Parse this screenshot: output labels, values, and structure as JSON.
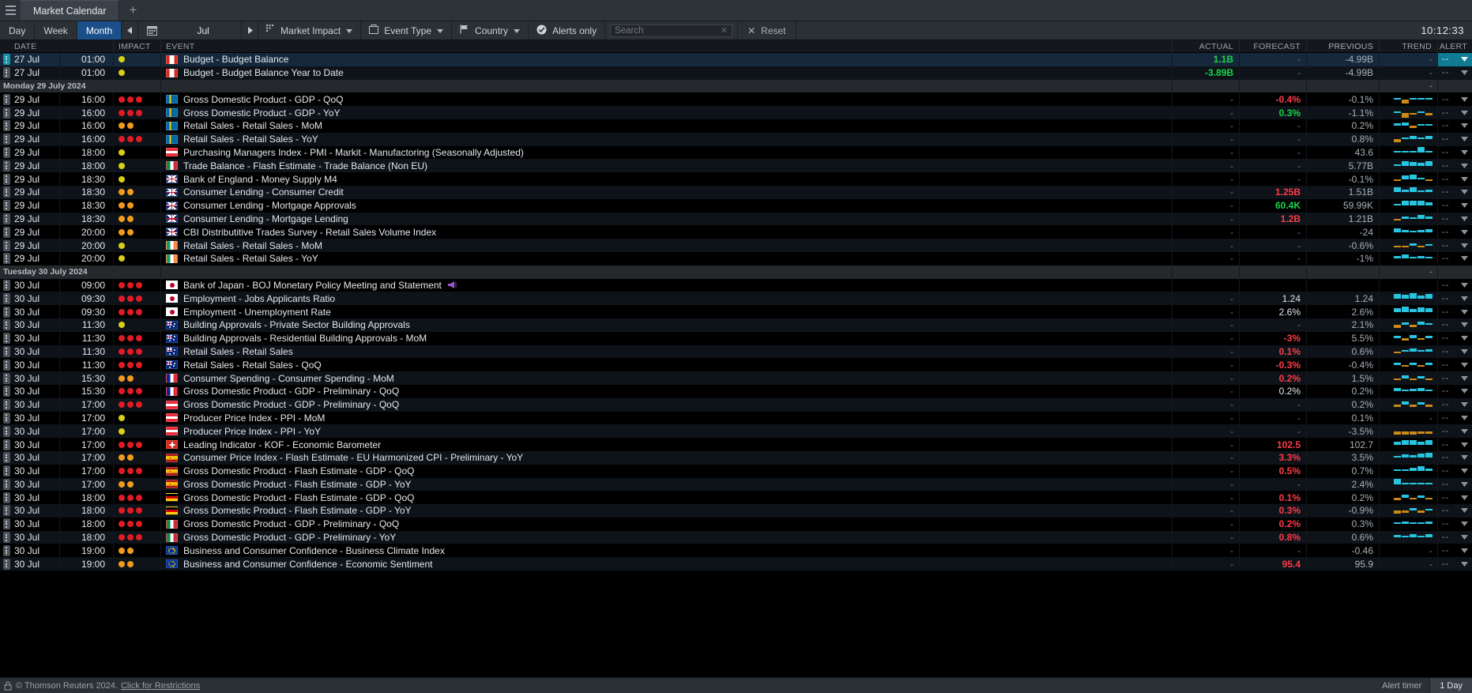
{
  "window": {
    "tab_title": "Market Calendar",
    "add_tab": "+"
  },
  "toolbar": {
    "views": [
      "Day",
      "Week",
      "Month"
    ],
    "selected_view": "Month",
    "prev_arrow": "◀",
    "next_arrow": "▶",
    "month_label": "Jul",
    "filters": [
      {
        "label": "Market Impact",
        "icon": "dots-grid-icon"
      },
      {
        "label": "Event Type",
        "icon": "calendar-box-icon"
      },
      {
        "label": "Country",
        "icon": "flag-icon"
      }
    ],
    "alerts_only": "Alerts only",
    "search_placeholder": "Search",
    "reset_label": "Reset",
    "clock": "10:12:33"
  },
  "columns": [
    "DATE",
    "IMPACT",
    "EVENT",
    "ACTUAL",
    "FORECAST",
    "PREVIOUS",
    "TREND",
    "ALERT"
  ],
  "colors": {
    "positive": "#19d44a",
    "negative": "#ff3b4a",
    "selection": "#16293c",
    "alert_active": "#0f7c93",
    "impact_high": "#e01b24",
    "impact_med": "#f29a1d",
    "impact_low": "#d9cf17",
    "spark_up": "#29c5e0",
    "spark_down": "#c98a18"
  },
  "rows": [
    {
      "kind": "event",
      "selected": true,
      "handle": "active",
      "date": "27 Jul",
      "time": "01:00",
      "impact": [
        "y"
      ],
      "flag": "ca",
      "event": "Budget - Budget Balance",
      "actual": "1.1B",
      "actual_tone": "pos",
      "forecast": "-",
      "forecast_tone": "dash",
      "previous": "-4.99B",
      "trend": [],
      "trend_dash": true,
      "alert": "--"
    },
    {
      "kind": "event",
      "handle": "idle",
      "date": "27 Jul",
      "time": "01:00",
      "impact": [
        "y"
      ],
      "flag": "ca",
      "event": "Budget - Budget Balance Year to Date",
      "actual": "-3.89B",
      "actual_tone": "pos",
      "forecast": "-",
      "forecast_tone": "dash",
      "previous": "-4.99B",
      "trend": [],
      "trend_dash": true,
      "alert": "--"
    },
    {
      "kind": "day",
      "label": "Monday 29 July 2024"
    },
    {
      "kind": "event",
      "handle": "idle",
      "date": "29 Jul",
      "time": "16:00",
      "impact": [
        "r",
        "r",
        "r"
      ],
      "flag": "se",
      "event": "Gross Domestic Product - GDP - QoQ",
      "actual": "-",
      "actual_tone": "dash",
      "forecast": "-0.4%",
      "forecast_tone": "neg",
      "previous": "-0.1%",
      "trend": [
        8,
        -38,
        6,
        4,
        3
      ],
      "alert": "--"
    },
    {
      "kind": "event",
      "handle": "idle",
      "date": "29 Jul",
      "time": "16:00",
      "impact": [
        "r",
        "r",
        "r"
      ],
      "flag": "se",
      "event": "Gross Domestic Product - GDP - YoY",
      "actual": "-",
      "actual_tone": "dash",
      "forecast": "0.3%",
      "forecast_tone": "pos",
      "previous": "-1.1%",
      "trend": [
        6,
        -42,
        -18,
        4,
        -22
      ],
      "alert": "--"
    },
    {
      "kind": "event",
      "handle": "idle",
      "date": "29 Jul",
      "time": "16:00",
      "impact": [
        "o",
        "o"
      ],
      "flag": "se",
      "event": "Retail Sales - Retail Sales - MoM",
      "actual": "-",
      "actual_tone": "dash",
      "forecast": "-",
      "forecast_tone": "dash",
      "previous": "0.2%",
      "trend": [
        22,
        30,
        -20,
        14,
        12
      ],
      "alert": "--"
    },
    {
      "kind": "event",
      "handle": "idle",
      "date": "29 Jul",
      "time": "16:00",
      "impact": [
        "r",
        "r",
        "r"
      ],
      "flag": "se",
      "event": "Retail Sales - Retail Sales - YoY",
      "actual": "-",
      "actual_tone": "dash",
      "forecast": "-",
      "forecast_tone": "dash",
      "previous": "0.8%",
      "trend": [
        -24,
        12,
        26,
        12,
        26
      ],
      "alert": "--"
    },
    {
      "kind": "event",
      "handle": "idle",
      "date": "29 Jul",
      "time": "18:00",
      "impact": [
        "y"
      ],
      "flag": "at",
      "event": "Purchasing Managers Index - PMI - Markit - Manufactoring (Seasonally Adjusted)",
      "actual": "-",
      "actual_tone": "dash",
      "forecast": "-",
      "forecast_tone": "dash",
      "previous": "43.6",
      "trend": [
        4,
        4,
        12,
        46,
        10
      ],
      "alert": "--"
    },
    {
      "kind": "event",
      "handle": "idle",
      "date": "29 Jul",
      "time": "18:00",
      "impact": [
        "y"
      ],
      "flag": "it",
      "event": "Trade Balance - Flash Estimate - Trade Balance (Non EU)",
      "actual": "-",
      "actual_tone": "dash",
      "forecast": "-",
      "forecast_tone": "dash",
      "previous": "5.77B",
      "trend": [
        4,
        36,
        30,
        26,
        36
      ],
      "alert": "--"
    },
    {
      "kind": "event",
      "handle": "idle",
      "date": "29 Jul",
      "time": "18:30",
      "impact": [
        "y"
      ],
      "flag": "gb",
      "event": "Bank of England - Money Supply M4",
      "actual": "-",
      "actual_tone": "dash",
      "forecast": "-",
      "forecast_tone": "dash",
      "previous": "-0.1%",
      "trend": [
        -8,
        28,
        38,
        6,
        -8
      ],
      "alert": "--"
    },
    {
      "kind": "event",
      "handle": "idle",
      "date": "29 Jul",
      "time": "18:30",
      "impact": [
        "o",
        "o"
      ],
      "flag": "gb",
      "event": "Consumer Lending - Consumer Credit",
      "actual": "-",
      "actual_tone": "dash",
      "forecast": "1.25B",
      "forecast_tone": "neg",
      "previous": "1.51B",
      "trend": [
        40,
        24,
        40,
        6,
        24
      ],
      "alert": "--"
    },
    {
      "kind": "event",
      "handle": "idle",
      "date": "29 Jul",
      "time": "18:30",
      "impact": [
        "o",
        "o"
      ],
      "flag": "gb",
      "event": "Consumer Lending - Mortgage Approvals",
      "actual": "-",
      "actual_tone": "dash",
      "forecast": "60.4K",
      "forecast_tone": "pos",
      "previous": "59.99K",
      "trend": [
        6,
        38,
        44,
        44,
        30
      ],
      "alert": "--"
    },
    {
      "kind": "event",
      "handle": "idle",
      "date": "29 Jul",
      "time": "18:30",
      "impact": [
        "o",
        "o"
      ],
      "flag": "gb",
      "event": "Consumer Lending - Mortgage Lending",
      "actual": "-",
      "actual_tone": "dash",
      "forecast": "1.2B",
      "forecast_tone": "neg",
      "previous": "1.21B",
      "trend": [
        -14,
        22,
        6,
        36,
        20
      ],
      "alert": "--"
    },
    {
      "kind": "event",
      "handle": "idle",
      "date": "29 Jul",
      "time": "20:00",
      "impact": [
        "o",
        "o"
      ],
      "flag": "gb",
      "event": "CBI Distributitive Trades Survey - Retail Sales Volume Index",
      "actual": "-",
      "actual_tone": "dash",
      "forecast": "-",
      "forecast_tone": "dash",
      "previous": "-24",
      "trend": [
        30,
        20,
        8,
        16,
        24
      ],
      "alert": "--"
    },
    {
      "kind": "event",
      "handle": "idle",
      "date": "29 Jul",
      "time": "20:00",
      "impact": [
        "y"
      ],
      "flag": "ie",
      "event": "Retail Sales - Retail Sales - MoM",
      "actual": "-",
      "actual_tone": "dash",
      "forecast": "-",
      "forecast_tone": "dash",
      "previous": "-0.6%",
      "trend": [
        -16,
        -10,
        14,
        -12,
        8
      ],
      "alert": "--"
    },
    {
      "kind": "event",
      "handle": "idle",
      "date": "29 Jul",
      "time": "20:00",
      "impact": [
        "y"
      ],
      "flag": "ie",
      "event": "Retail Sales - Retail Sales - YoY",
      "actual": "-",
      "actual_tone": "dash",
      "forecast": "-",
      "forecast_tone": "dash",
      "previous": "-1%",
      "trend": [
        24,
        36,
        16,
        22,
        14
      ],
      "alert": "--"
    },
    {
      "kind": "day",
      "label": "Tuesday 30 July 2024"
    },
    {
      "kind": "event",
      "handle": "idle",
      "date": "30 Jul",
      "time": "09:00",
      "impact": [
        "r",
        "r",
        "r"
      ],
      "flag": "jp",
      "event": "Bank of Japan - BOJ Monetary Policy Meeting and Statement",
      "speaker": true,
      "actual": "",
      "actual_tone": "none",
      "forecast": "",
      "forecast_tone": "none",
      "previous": "",
      "trend": [],
      "alert": "--"
    },
    {
      "kind": "event",
      "handle": "idle",
      "date": "30 Jul",
      "time": "09:30",
      "impact": [
        "r",
        "r",
        "r"
      ],
      "flag": "jp",
      "event": "Employment - Jobs Applicants Ratio",
      "actual": "-",
      "actual_tone": "dash",
      "forecast": "1.24",
      "forecast_tone": "plain",
      "previous": "1.24",
      "trend": [
        38,
        30,
        44,
        26,
        38
      ],
      "alert": "--"
    },
    {
      "kind": "event",
      "handle": "idle",
      "date": "30 Jul",
      "time": "09:30",
      "impact": [
        "r",
        "r",
        "r"
      ],
      "flag": "jp",
      "event": "Employment - Unemployment Rate",
      "actual": "-",
      "actual_tone": "dash",
      "forecast": "2.6%",
      "forecast_tone": "plain",
      "previous": "2.6%",
      "trend": [
        30,
        44,
        26,
        38,
        30
      ],
      "alert": "--"
    },
    {
      "kind": "event",
      "handle": "idle",
      "date": "30 Jul",
      "time": "11:30",
      "impact": [
        "y"
      ],
      "flag": "au",
      "event": "Building Approvals - Private Sector Building Approvals",
      "actual": "-",
      "actual_tone": "dash",
      "forecast": "-",
      "forecast_tone": "dash",
      "previous": "2.1%",
      "trend": [
        -22,
        20,
        -18,
        26,
        12
      ],
      "alert": "--"
    },
    {
      "kind": "event",
      "handle": "idle",
      "date": "30 Jul",
      "time": "11:30",
      "impact": [
        "r",
        "r",
        "r"
      ],
      "flag": "au",
      "event": "Building Approvals - Residential Building Approvals - MoM",
      "actual": "-",
      "actual_tone": "dash",
      "forecast": "-3%",
      "forecast_tone": "neg",
      "previous": "5.5%",
      "trend": [
        20,
        -20,
        26,
        -14,
        20
      ],
      "alert": "--"
    },
    {
      "kind": "event",
      "handle": "idle",
      "date": "30 Jul",
      "time": "11:30",
      "impact": [
        "r",
        "r",
        "r"
      ],
      "flag": "au",
      "event": "Retail Sales - Retail Sales",
      "actual": "-",
      "actual_tone": "dash",
      "forecast": "0.1%",
      "forecast_tone": "neg",
      "previous": "0.6%",
      "trend": [
        -10,
        14,
        26,
        10,
        18
      ],
      "alert": "--"
    },
    {
      "kind": "event",
      "handle": "idle",
      "date": "30 Jul",
      "time": "11:30",
      "impact": [
        "r",
        "r",
        "r"
      ],
      "flag": "au",
      "event": "Retail Sales - Retail Sales - QoQ",
      "actual": "-",
      "actual_tone": "dash",
      "forecast": "-0.3%",
      "forecast_tone": "neg",
      "previous": "-0.4%",
      "trend": [
        16,
        -16,
        20,
        -12,
        16
      ],
      "alert": "--"
    },
    {
      "kind": "event",
      "handle": "idle",
      "date": "30 Jul",
      "time": "15:30",
      "impact": [
        "o",
        "o"
      ],
      "flag": "fr",
      "event": "Consumer Spending - Consumer Spending - MoM",
      "actual": "-",
      "actual_tone": "dash",
      "forecast": "0.2%",
      "forecast_tone": "neg",
      "previous": "1.5%",
      "trend": [
        -16,
        22,
        -14,
        18,
        -10
      ],
      "alert": "--"
    },
    {
      "kind": "event",
      "handle": "idle",
      "date": "30 Jul",
      "time": "15:30",
      "impact": [
        "r",
        "r",
        "r"
      ],
      "flag": "fr",
      "event": "Gross Domestic Product - GDP - Preliminary - QoQ",
      "actual": "-",
      "actual_tone": "dash",
      "forecast": "0.2%",
      "forecast_tone": "plain",
      "previous": "0.2%",
      "trend": [
        30,
        16,
        24,
        30,
        14
      ],
      "alert": "--"
    },
    {
      "kind": "event",
      "handle": "idle",
      "date": "30 Jul",
      "time": "17:00",
      "impact": [
        "r",
        "r",
        "r"
      ],
      "flag": "at",
      "event": "Gross Domestic Product - GDP - Preliminary - QoQ",
      "actual": "-",
      "actual_tone": "dash",
      "forecast": "-",
      "forecast_tone": "dash",
      "previous": "0.2%",
      "trend": [
        -20,
        26,
        -18,
        22,
        -16
      ],
      "alert": "--"
    },
    {
      "kind": "event",
      "handle": "idle",
      "date": "30 Jul",
      "time": "17:00",
      "impact": [
        "y"
      ],
      "flag": "at",
      "event": "Producer Price Index - PPI - MoM",
      "actual": "-",
      "actual_tone": "dash",
      "forecast": "-",
      "forecast_tone": "dash",
      "previous": "0.1%",
      "trend": [],
      "trend_dash": true,
      "alert": "--"
    },
    {
      "kind": "event",
      "handle": "idle",
      "date": "30 Jul",
      "time": "17:00",
      "impact": [
        "y"
      ],
      "flag": "at",
      "event": "Producer Price Index - PPI - YoY",
      "actual": "-",
      "actual_tone": "dash",
      "forecast": "-",
      "forecast_tone": "dash",
      "previous": "-3.5%",
      "trend": [
        -26,
        -30,
        -28,
        -24,
        -20
      ],
      "alert": "--"
    },
    {
      "kind": "event",
      "handle": "idle",
      "date": "30 Jul",
      "time": "17:00",
      "impact": [
        "r",
        "r",
        "r"
      ],
      "flag": "ch",
      "event": "Leading Indicator - KOF - Economic Barometer",
      "actual": "-",
      "actual_tone": "dash",
      "forecast": "102.5",
      "forecast_tone": "neg",
      "previous": "102.7",
      "trend": [
        26,
        36,
        40,
        22,
        36
      ],
      "alert": "--"
    },
    {
      "kind": "event",
      "handle": "idle",
      "date": "30 Jul",
      "time": "17:00",
      "impact": [
        "o",
        "o"
      ],
      "flag": "es",
      "event": "Consumer Price Index - Flash Estimate - EU Harmonized CPI - Preliminary - YoY",
      "actual": "-",
      "actual_tone": "dash",
      "forecast": "3.3%",
      "forecast_tone": "neg",
      "previous": "3.5%",
      "trend": [
        14,
        28,
        20,
        34,
        40
      ],
      "alert": "--"
    },
    {
      "kind": "event",
      "handle": "idle",
      "date": "30 Jul",
      "time": "17:00",
      "impact": [
        "r",
        "r",
        "r"
      ],
      "flag": "es",
      "event": "Gross Domestic Product - Flash Estimate - GDP - QoQ",
      "actual": "-",
      "actual_tone": "dash",
      "forecast": "0.5%",
      "forecast_tone": "neg",
      "previous": "0.7%",
      "trend": [
        16,
        10,
        30,
        40,
        24
      ],
      "alert": "--"
    },
    {
      "kind": "event",
      "handle": "idle",
      "date": "30 Jul",
      "time": "17:00",
      "impact": [
        "o",
        "o"
      ],
      "flag": "es",
      "event": "Gross Domestic Product - Flash Estimate - GDP - YoY",
      "actual": "-",
      "actual_tone": "dash",
      "forecast": "-",
      "forecast_tone": "dash",
      "previous": "2.4%",
      "trend": [
        44,
        16,
        12,
        10,
        8
      ],
      "alert": "--"
    },
    {
      "kind": "event",
      "handle": "idle",
      "date": "30 Jul",
      "time": "18:00",
      "impact": [
        "r",
        "r",
        "r"
      ],
      "flag": "de",
      "event": "Gross Domestic Product - Flash Estimate - GDP - QoQ",
      "actual": "-",
      "actual_tone": "dash",
      "forecast": "0.1%",
      "forecast_tone": "neg",
      "previous": "0.2%",
      "trend": [
        -20,
        24,
        -16,
        20,
        -18
      ],
      "alert": "--"
    },
    {
      "kind": "event",
      "handle": "idle",
      "date": "30 Jul",
      "time": "18:00",
      "impact": [
        "r",
        "r",
        "r"
      ],
      "flag": "de",
      "event": "Gross Domestic Product - Flash Estimate - GDP - YoY",
      "actual": "-",
      "actual_tone": "dash",
      "forecast": "0.3%",
      "forecast_tone": "neg",
      "previous": "-0.9%",
      "trend": [
        -22,
        -18,
        20,
        -16,
        18
      ],
      "alert": "--"
    },
    {
      "kind": "event",
      "handle": "idle",
      "date": "30 Jul",
      "time": "18:00",
      "impact": [
        "r",
        "r",
        "r"
      ],
      "flag": "it",
      "event": "Gross Domestic Product - GDP - Preliminary - QoQ",
      "actual": "-",
      "actual_tone": "dash",
      "forecast": "0.2%",
      "forecast_tone": "neg",
      "previous": "0.3%",
      "trend": [
        16,
        24,
        18,
        10,
        20
      ],
      "alert": "--"
    },
    {
      "kind": "event",
      "handle": "idle",
      "date": "30 Jul",
      "time": "18:00",
      "impact": [
        "r",
        "r",
        "r"
      ],
      "flag": "it",
      "event": "Gross Domestic Product - GDP - Preliminary - YoY",
      "actual": "-",
      "actual_tone": "dash",
      "forecast": "0.8%",
      "forecast_tone": "neg",
      "previous": "0.6%",
      "trend": [
        20,
        14,
        26,
        16,
        24
      ],
      "alert": "--"
    },
    {
      "kind": "event",
      "handle": "idle",
      "date": "30 Jul",
      "time": "19:00",
      "impact": [
        "o",
        "o"
      ],
      "flag": "eu",
      "event": "Business and Consumer Confidence - Business Climate Index",
      "actual": "-",
      "actual_tone": "dash",
      "forecast": "-",
      "forecast_tone": "dash",
      "previous": "-0.46",
      "trend": [],
      "trend_dash": true,
      "alert": "--"
    },
    {
      "kind": "event",
      "handle": "idle",
      "date": "30 Jul",
      "time": "19:00",
      "impact": [
        "o",
        "o"
      ],
      "flag": "eu",
      "event": "Business and Consumer Confidence - Economic Sentiment",
      "actual": "-",
      "actual_tone": "dash",
      "forecast": "95.4",
      "forecast_tone": "neg",
      "previous": "95.9",
      "trend": [],
      "trend_dash": true,
      "alert": "--"
    }
  ],
  "statusbar": {
    "copyright": "© Thomson Reuters 2024.",
    "link": "Click for Restrictions",
    "alert_timer_label": "Alert timer",
    "alert_timer_value": "1 Day"
  }
}
